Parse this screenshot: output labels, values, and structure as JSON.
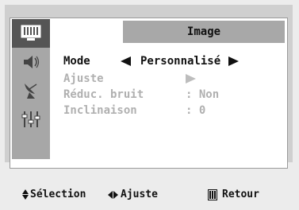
{
  "menu": {
    "title": "Image",
    "icons": [
      {
        "name": "picture-menu-icon",
        "active": true
      },
      {
        "name": "sound-icon",
        "active": false
      },
      {
        "name": "antenna-icon",
        "active": false
      },
      {
        "name": "setup-sliders-icon",
        "active": false
      },
      {
        "name": "empty-icon-slot",
        "active": false
      }
    ],
    "rows": [
      {
        "label": "Mode",
        "value": "Personnalisé",
        "state": "active"
      },
      {
        "label": "Ajuste",
        "value": "",
        "state": "inactive"
      },
      {
        "label": "Réduc. bruit",
        "value": ": Non",
        "state": "inactive"
      },
      {
        "label": "Inclinaison",
        "value": ": 0",
        "state": "inactive"
      }
    ]
  },
  "footer": {
    "select_label": "Sélection",
    "adjust_label": "Ajuste",
    "return_label": "Retour"
  },
  "colors": {
    "frame": "#cfcfcf",
    "panel": "#ffffff",
    "icon_column": "#a7a7a7",
    "active_icon": "#555555",
    "header": "#a8a8a8",
    "inactive_text": "#b0b0b0"
  }
}
